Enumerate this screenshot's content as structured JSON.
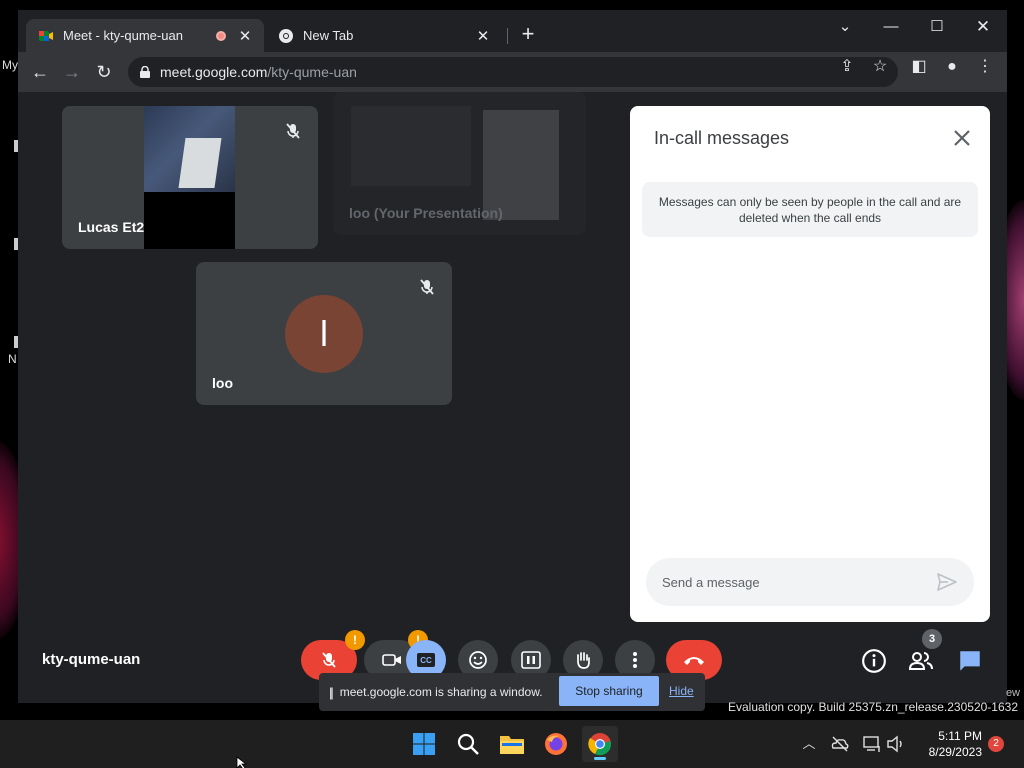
{
  "browser": {
    "tabs": [
      {
        "title": "Meet - kty-qume-uan",
        "active": true,
        "recording": true,
        "favicon": "google-meet-icon"
      },
      {
        "title": "New Tab",
        "active": false,
        "favicon": "chrome-icon"
      }
    ],
    "address": {
      "host": "meet.google.com",
      "path": "/kty-qume-uan"
    }
  },
  "meet": {
    "participants": [
      {
        "name": "Lucas Et2",
        "muted": true
      },
      {
        "name": "loo (Your Presentation)"
      },
      {
        "name": "loo",
        "avatar_initial": "l",
        "muted": true
      }
    ],
    "meeting_code": "kty-qume-uan",
    "people_count": "3",
    "warn_badge": "!"
  },
  "chat": {
    "title": "In-call messages",
    "notice": "Messages can only be seen by people in the call and are deleted when the call ends",
    "input_placeholder": "Send a message"
  },
  "share_bar": {
    "text": "meet.google.com is sharing a window.",
    "stop_label": "Stop sharing",
    "hide_label": "Hide"
  },
  "desktop": {
    "watermark": "Evaluation copy. Build 25375.zn_release.230520-1632",
    "watermark_fragment": "ew",
    "left_fragments": [
      "My",
      "N"
    ]
  },
  "taskbar": {
    "time": "5:11 PM",
    "date": "8/29/2023",
    "notifications": "2"
  },
  "colors": {
    "meet_red": "#ea4335",
    "meet_blue": "#8ab4f8",
    "warning_orange": "#f29900",
    "tile_bg": "#3c4043"
  }
}
